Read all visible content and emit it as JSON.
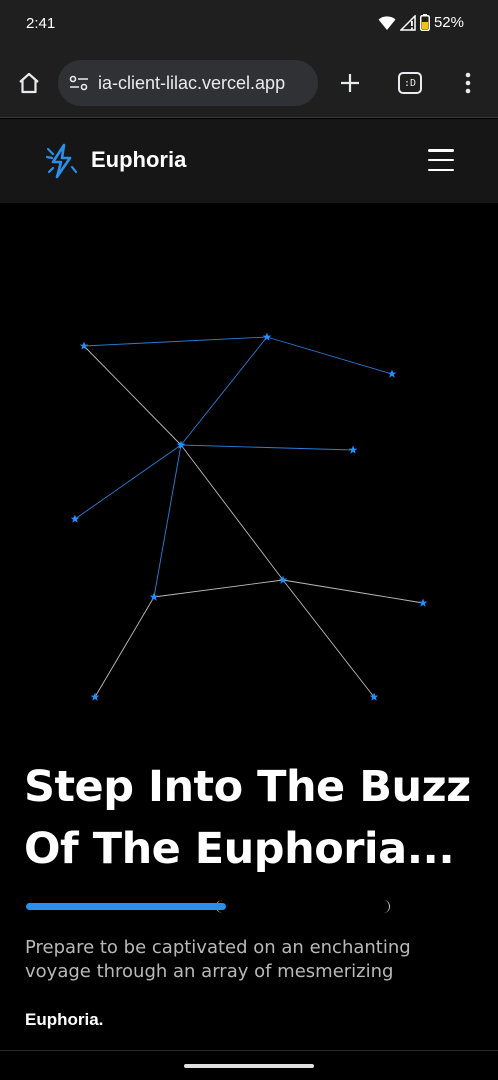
{
  "status_bar": {
    "time": "2:41",
    "battery": "52%",
    "icons": [
      "wifi-icon",
      "signal-icon",
      "battery-icon"
    ]
  },
  "browser": {
    "url": "ia-client-lilac.vercel.app",
    "tab_count": ":D",
    "icons": [
      "home-icon",
      "tune-icon",
      "plus-icon",
      "tabs-icon",
      "more-vert-icon"
    ]
  },
  "site": {
    "brand_name": "Euphoria",
    "logo_icon": "lightning-icon",
    "menu_icon": "hamburger-icon"
  },
  "hero": {
    "title_line1": "Step Into The Buzz",
    "title_line2": "Of The Euphoria...",
    "progress_fraction": 0.5,
    "description": "Prepare to be captivated on an enchanting voyage through an array of mesmerizing",
    "footer_brand": "Euphoria."
  },
  "colors": {
    "accent_blue": "#2a8fe8",
    "star_blue": "#1e90ff",
    "background": "#000000",
    "header_bg": "#161616",
    "browser_bg": "#1f1f1f"
  }
}
